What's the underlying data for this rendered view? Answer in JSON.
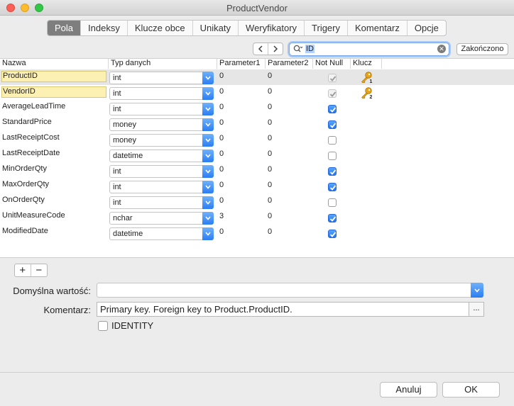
{
  "window": {
    "title": "ProductVendor"
  },
  "tabs": [
    {
      "label": "Pola",
      "active": true
    },
    {
      "label": "Indeksy"
    },
    {
      "label": "Klucze obce"
    },
    {
      "label": "Unikaty"
    },
    {
      "label": "Weryfikatory"
    },
    {
      "label": "Trigery"
    },
    {
      "label": "Komentarz"
    },
    {
      "label": "Opcje"
    }
  ],
  "search": {
    "value": "ID",
    "icons": [
      "chevron-left-icon",
      "chevron-right-icon",
      "search-icon",
      "clear-icon"
    ]
  },
  "done_button": "Zakończono",
  "table": {
    "columns": [
      "Nazwa",
      "Typ danych",
      "Parameter1",
      "Parameter2",
      "Not Null",
      "Klucz"
    ],
    "rows": [
      {
        "name": "ProductID",
        "type": "int",
        "p1": "0",
        "p2": "0",
        "notnull": "disabled-checked",
        "key": "1"
      },
      {
        "name": "VendorID",
        "type": "int",
        "p1": "0",
        "p2": "0",
        "notnull": "disabled-checked",
        "key": "2"
      },
      {
        "name": "AverageLeadTime",
        "type": "int",
        "p1": "0",
        "p2": "0",
        "notnull": "checked",
        "key": ""
      },
      {
        "name": "StandardPrice",
        "type": "money",
        "p1": "0",
        "p2": "0",
        "notnull": "checked",
        "key": ""
      },
      {
        "name": "LastReceiptCost",
        "type": "money",
        "p1": "0",
        "p2": "0",
        "notnull": "unchecked",
        "key": ""
      },
      {
        "name": "LastReceiptDate",
        "type": "datetime",
        "p1": "0",
        "p2": "0",
        "notnull": "unchecked",
        "key": ""
      },
      {
        "name": "MinOrderQty",
        "type": "int",
        "p1": "0",
        "p2": "0",
        "notnull": "checked",
        "key": ""
      },
      {
        "name": "MaxOrderQty",
        "type": "int",
        "p1": "0",
        "p2": "0",
        "notnull": "checked",
        "key": ""
      },
      {
        "name": "OnOrderQty",
        "type": "int",
        "p1": "0",
        "p2": "0",
        "notnull": "unchecked",
        "key": ""
      },
      {
        "name": "UnitMeasureCode",
        "type": "nchar",
        "p1": "3",
        "p2": "0",
        "notnull": "checked",
        "key": ""
      },
      {
        "name": "ModifiedDate",
        "type": "datetime",
        "p1": "0",
        "p2": "0",
        "notnull": "checked",
        "key": ""
      }
    ]
  },
  "toolbar": {
    "add": "+",
    "remove": "−"
  },
  "form": {
    "default_label": "Domyślna wartość:",
    "default_value": "",
    "comment_label": "Komentarz:",
    "comment_value": "Primary key. Foreign key to Product.ProductID.",
    "comment_more": "...",
    "identity_label": "IDENTITY"
  },
  "buttons": {
    "cancel": "Anuluj",
    "ok": "OK"
  },
  "colors": {
    "accent": "#2b7ef2",
    "key_fill": "#e8a417",
    "pk_cell": "#fdf0b3",
    "active_tab": "#7e7e7e"
  }
}
